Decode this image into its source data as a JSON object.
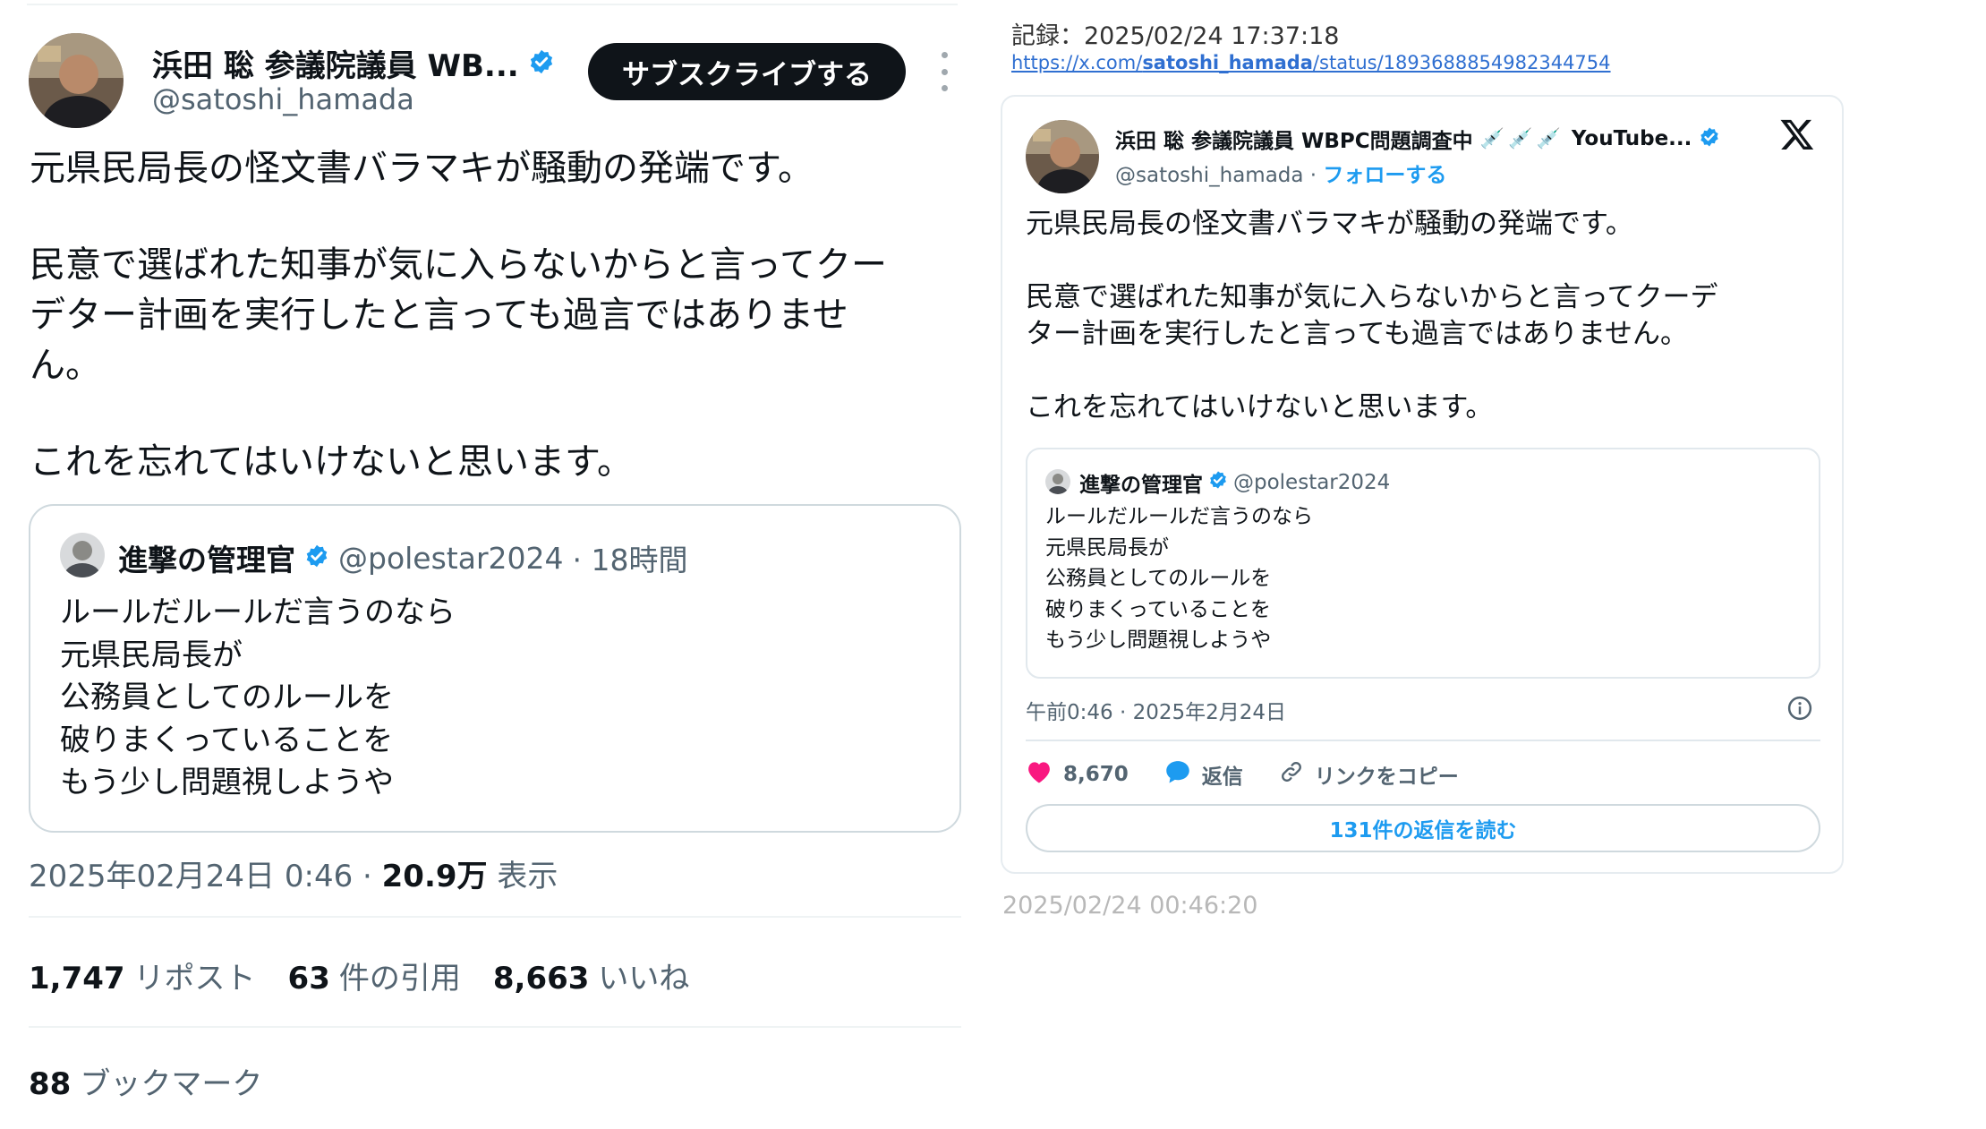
{
  "left": {
    "author": {
      "name": "浜田 聡 参議院議員 WB...",
      "handle": "@satoshi_hamada"
    },
    "subscribe_label": "サブスクライブする",
    "body": {
      "p1": "元県民局長の怪文書バラマキが騒動の発端です。",
      "p2_line1": "民意で選ばれた知事が気に入らないからと言ってクー",
      "p2_line2": "デター計画を実行したと言っても過言ではありませ",
      "p2_line3": "ん。",
      "p3": "これを忘れてはいけないと思います。"
    },
    "quote": {
      "name": "進撃の管理官",
      "handle": "@polestar2024",
      "time": "· 18時間",
      "lines": [
        "ルールだルールだ言うのなら",
        "元県民局長が",
        "公務員としてのルールを",
        "破りまくっていることを",
        "もう少し問題視しようや"
      ]
    },
    "meta": {
      "datetime": "2025年02月24日 0:46 · ",
      "views": "20.9万",
      "views_label": "表示"
    },
    "stats": {
      "reposts": "1,747",
      "reposts_label": "リポスト",
      "quotes": "63",
      "quotes_label": "件の引用",
      "likes": "8,663",
      "likes_label": "いいね"
    },
    "bookmarks": {
      "count": "88",
      "label": "ブックマーク"
    }
  },
  "right": {
    "record": "記録：2025/02/24 17:37:18",
    "url_prefix": "https://x.com/",
    "url_user": "satoshi_hamada",
    "url_suffix": "/status/1893688854982344754",
    "author": {
      "name": "浜田 聡 参議院議員 WBPC問題調査中",
      "name_suffix": "YouTube...",
      "handle": "@satoshi_hamada · ",
      "follow": "フォローする"
    },
    "body": {
      "p1": "元県民局長の怪文書バラマキが騒動の発端です。",
      "p2_line1": "民意で選ばれた知事が気に入らないからと言ってクーデ",
      "p2_line2": "ター計画を実行したと言っても過言ではありません。",
      "p3": "これを忘れてはいけないと思います。"
    },
    "quote": {
      "name": "進撃の管理官",
      "handle": "@polestar2024",
      "lines": [
        "ルールだルールだ言うのなら",
        "元県民局長が",
        "公務員としてのルールを",
        "破りまくっていることを",
        "もう少し問題視しようや"
      ]
    },
    "time": "午前0:46 · 2025年2月24日",
    "actions": {
      "likes": "8,670",
      "reply": "返信",
      "copy_link": "リンクをコピー"
    },
    "replies_button": "131件の返信を読む",
    "footer_time": "2025/02/24 00:46:20"
  },
  "colors": {
    "verified": "#1d9bf0",
    "like": "#f91880",
    "accent": "#1d9bf0",
    "link": "#2f6fd1"
  }
}
